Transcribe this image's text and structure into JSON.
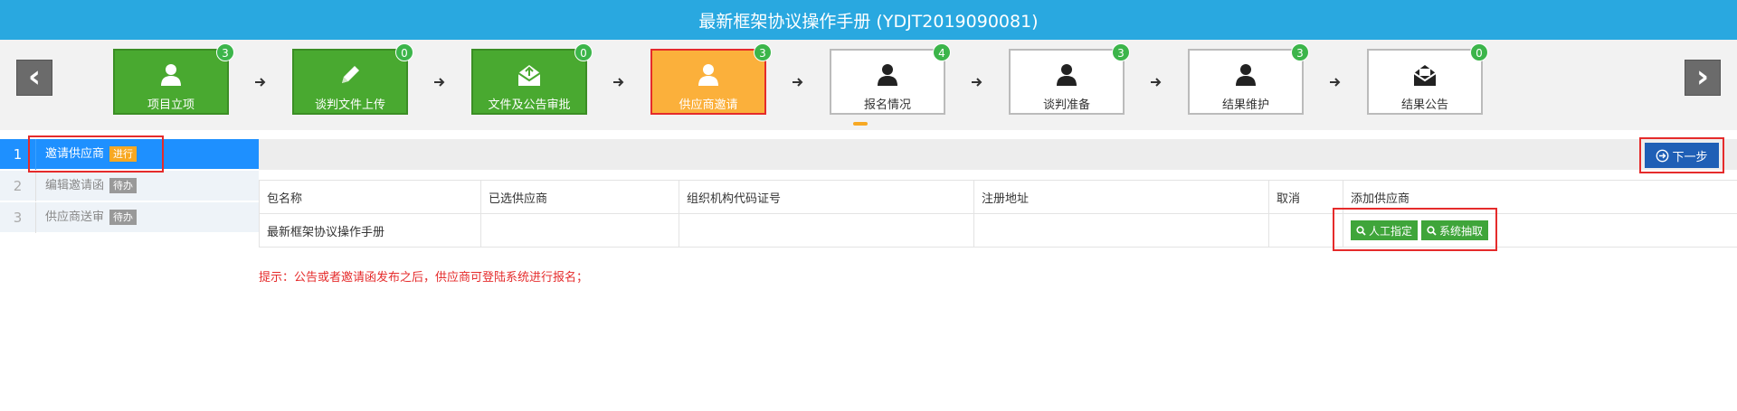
{
  "header": {
    "title": "最新框架协议操作手册 (YDJT2019090081)"
  },
  "nav": {
    "prev_label": "‹",
    "next_label": "›"
  },
  "steps": [
    {
      "label": "项目立项",
      "badge": "3",
      "state": "done",
      "icon": "user-icon"
    },
    {
      "label": "谈判文件上传",
      "badge": "0",
      "state": "done",
      "icon": "pencil-icon"
    },
    {
      "label": "文件及公告审批",
      "badge": "0",
      "state": "done",
      "icon": "mail-upload-icon"
    },
    {
      "label": "供应商邀请",
      "badge": "3",
      "state": "active",
      "icon": "user-icon"
    },
    {
      "label": "报名情况",
      "badge": "4",
      "state": "todo",
      "icon": "user-icon"
    },
    {
      "label": "谈判准备",
      "badge": "3",
      "state": "todo",
      "icon": "user-icon"
    },
    {
      "label": "结果维护",
      "badge": "3",
      "state": "todo",
      "icon": "user-icon"
    },
    {
      "label": "结果公告",
      "badge": "0",
      "state": "todo",
      "icon": "mail-icon"
    }
  ],
  "sidebar": {
    "items": [
      {
        "num": "1",
        "label": "邀请供应商",
        "tag": "进行"
      },
      {
        "num": "2",
        "label": "编辑邀请函",
        "tag": "待办"
      },
      {
        "num": "3",
        "label": "供应商送审",
        "tag": "待办"
      }
    ]
  },
  "toolbar": {
    "next_label": "下一步"
  },
  "table": {
    "headers": [
      "包名称",
      "已选供应商",
      "组织机构代码证号",
      "注册地址",
      "取消",
      "添加供应商"
    ],
    "rows": [
      {
        "package": "最新框架协议操作手册",
        "selected": "",
        "org_code": "",
        "address": "",
        "cancel": ""
      }
    ],
    "manual_btn": "人工指定",
    "system_btn": "系统抽取"
  },
  "hint": "提示：公告或者邀请函发布之后，供应商可登陆系统进行报名；",
  "colors": {
    "title_bar": "#29a8e0",
    "step_done": "#49a930",
    "step_active": "#fbb03b",
    "highlight": "#e52b2b",
    "primary": "#1f5fb6"
  }
}
